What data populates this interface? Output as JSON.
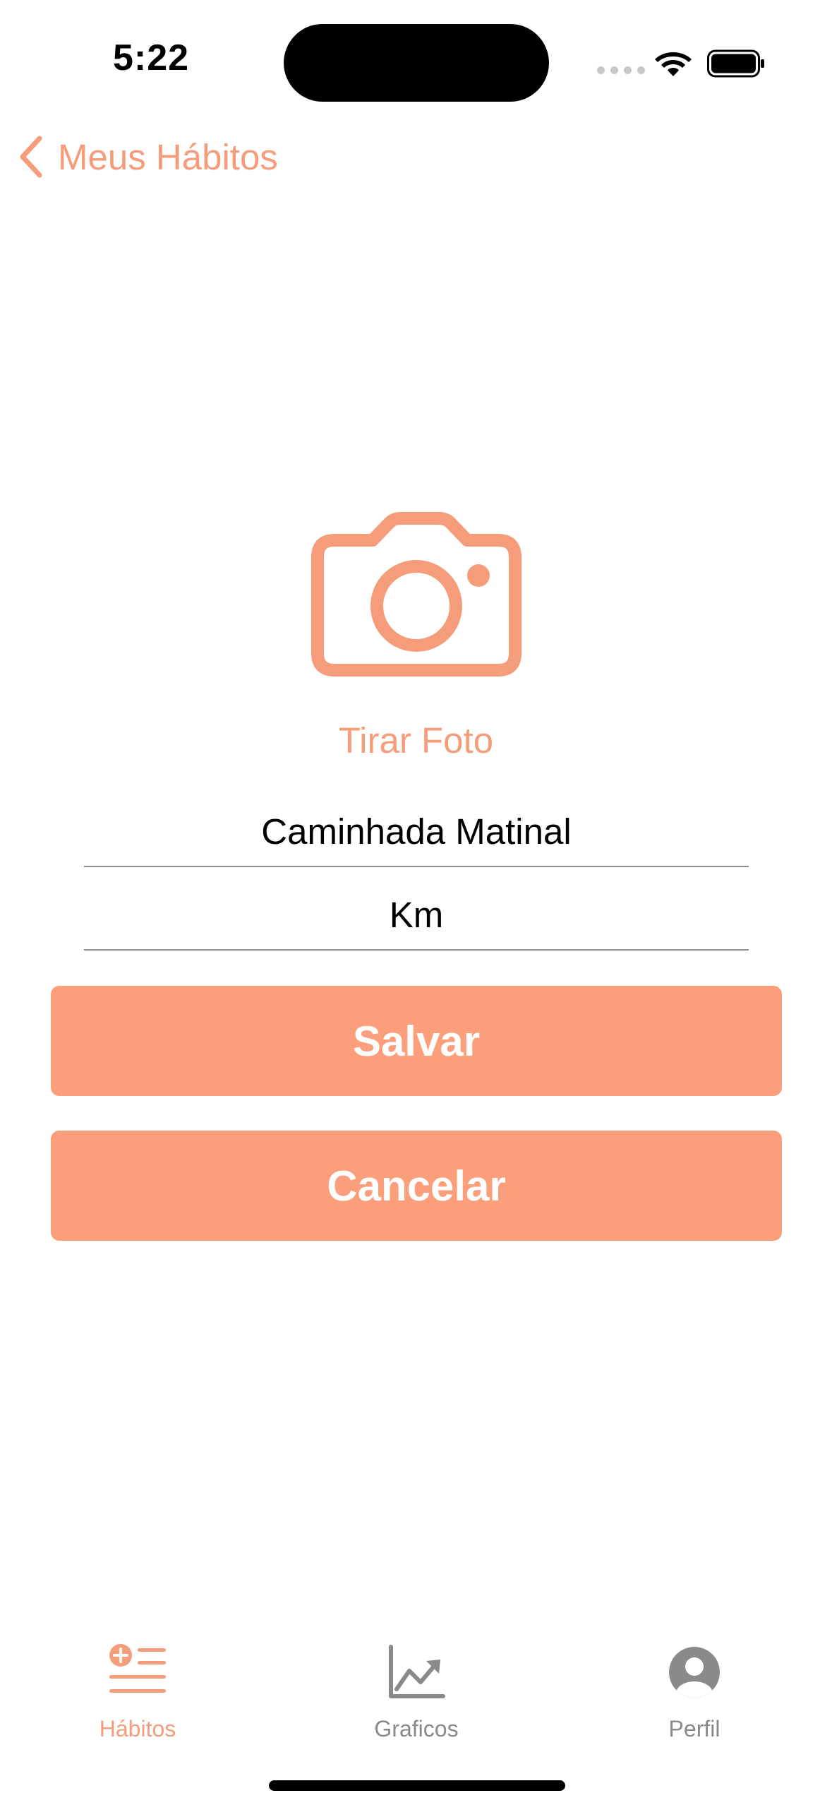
{
  "status_bar": {
    "time": "5:22",
    "icons": [
      "signal-dots-icon",
      "wifi-icon",
      "battery-icon"
    ]
  },
  "nav": {
    "back_label": "Meus Hábitos",
    "back_icon": "chevron-left-icon"
  },
  "photo": {
    "icon": "camera-icon",
    "label": "Tirar Foto"
  },
  "form": {
    "habit_name_value": "Caminhada Matinal",
    "unit_value": "Km"
  },
  "buttons": {
    "save_label": "Salvar",
    "cancel_label": "Cancelar"
  },
  "tab_bar": {
    "items": [
      {
        "label": "Hábitos",
        "icon": "habits-list-icon",
        "active": true
      },
      {
        "label": "Graficos",
        "icon": "chart-icon",
        "active": false
      },
      {
        "label": "Perfil",
        "icon": "profile-icon",
        "active": false
      }
    ]
  },
  "colors": {
    "accent": "#F59D7B",
    "button_bg": "#FB9E7C",
    "inactive": "#8A8A8A",
    "divider": "#8E8E8E"
  }
}
